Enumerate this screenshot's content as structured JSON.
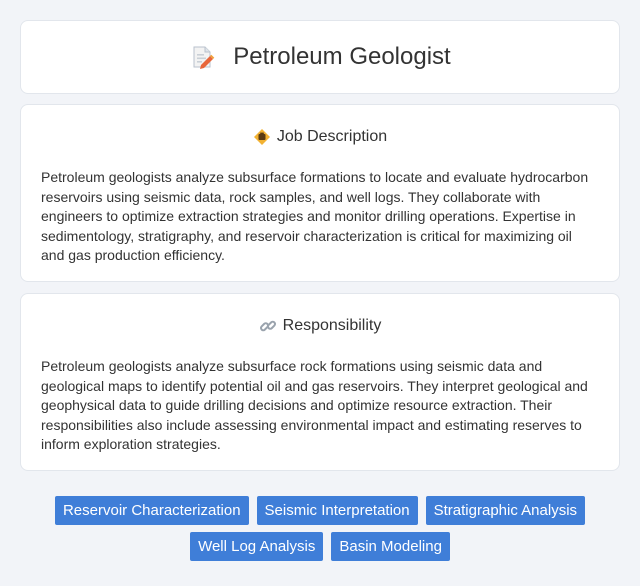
{
  "header": {
    "title": "Petroleum Geologist",
    "icon": "document-edit-icon"
  },
  "job_description": {
    "heading": "Job Description",
    "icon": "job-badge-icon",
    "text": "Petroleum geologists analyze subsurface formations to locate and evaluate hydrocarbon reservoirs using seismic data, rock samples, and well logs. They collaborate with engineers to optimize extraction strategies and monitor drilling operations. Expertise in sedimentology, stratigraphy, and reservoir characterization is critical for maximizing oil and gas production efficiency."
  },
  "responsibility": {
    "heading": "Responsibility",
    "icon": "link-icon",
    "text": "Petroleum geologists analyze subsurface rock formations using seismic data and geological maps to identify potential oil and gas reservoirs. They interpret geological and geophysical data to guide drilling decisions and optimize resource extraction. Their responsibilities also include assessing environmental impact and estimating reserves to inform exploration strategies."
  },
  "skills": [
    "Reservoir Characterization",
    "Seismic Interpretation",
    "Stratigraphic Analysis",
    "Well Log Analysis",
    "Basin Modeling"
  ],
  "colors": {
    "tag_bg": "#3f7ed8",
    "page_bg": "#f2f4f8",
    "card_bg": "#ffffff"
  }
}
